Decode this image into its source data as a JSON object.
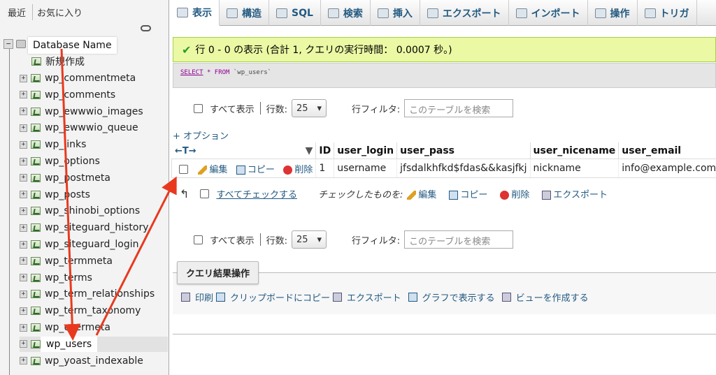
{
  "sidebar": {
    "tabs": [
      "最近",
      "お気に入り"
    ],
    "database_name": "Database Name",
    "new_item": "新規作成",
    "tables": [
      "wp_commentmeta",
      "wp_comments",
      "wp_ewwwio_images",
      "wp_ewwwio_queue",
      "wp_links",
      "wp_options",
      "wp_postmeta",
      "wp_posts",
      "wp_shinobi_options",
      "wp_siteguard_history",
      "wp_siteguard_login",
      "wp_termmeta",
      "wp_terms",
      "wp_term_relationships",
      "wp_term_taxonomy",
      "wp_usermeta",
      "wp_users",
      "wp_yoast_indexable"
    ],
    "selected_table": "wp_users"
  },
  "tabs": [
    {
      "label": "表示",
      "icon": "browse-icon"
    },
    {
      "label": "構造",
      "icon": "structure-icon"
    },
    {
      "label": "SQL",
      "icon": "sql-icon"
    },
    {
      "label": "検索",
      "icon": "search-icon"
    },
    {
      "label": "挿入",
      "icon": "insert-icon"
    },
    {
      "label": "エクスポート",
      "icon": "export-icon"
    },
    {
      "label": "インポート",
      "icon": "import-icon"
    },
    {
      "label": "操作",
      "icon": "wrench-icon"
    },
    {
      "label": "トリガ",
      "icon": "trigger-icon"
    }
  ],
  "message": {
    "success": "行 0 - 0 の表示 (合計 1, クエリの実行時間： 0.0007 秒。)"
  },
  "sql": {
    "select": "SELECT",
    "star": "*",
    "from": "FROM",
    "table": "`wp_users`"
  },
  "navigation": {
    "show_all": "すべて表示",
    "rows_label": "行数:",
    "rows_value": "25",
    "filter_label": "行フィルタ:",
    "filter_placeholder": "このテーブルを検索"
  },
  "options_link": "+ オプション",
  "results": {
    "arrows": "←T→",
    "columns": [
      "ID",
      "user_login",
      "user_pass",
      "user_nicename",
      "user_email"
    ],
    "row_actions": {
      "edit": "編集",
      "copy": "コピー",
      "delete": "削除"
    },
    "rows": [
      {
        "ID": "1",
        "user_login": "username",
        "user_pass": "jfsdalkhfkd$fdas&&kasjfkj",
        "user_nicename": "nickname",
        "user_email": "info@example.com"
      }
    ]
  },
  "bulk": {
    "check_all": "すべてチェックする",
    "with_selected": "チェックしたものを:",
    "edit": "編集",
    "copy": "コピー",
    "delete": "削除",
    "export": "エクスポート"
  },
  "query_ops": {
    "title": "クエリ結果操作",
    "print": "印刷",
    "copy_clipboard": "クリップボードにコピー",
    "export": "エクスポート",
    "chart": "グラフで表示する",
    "create_view": "ビューを作成する"
  },
  "colors": {
    "link": "#235a81",
    "success_bg": "#ebf8a4",
    "annotation_arrow": "#e8391e"
  }
}
